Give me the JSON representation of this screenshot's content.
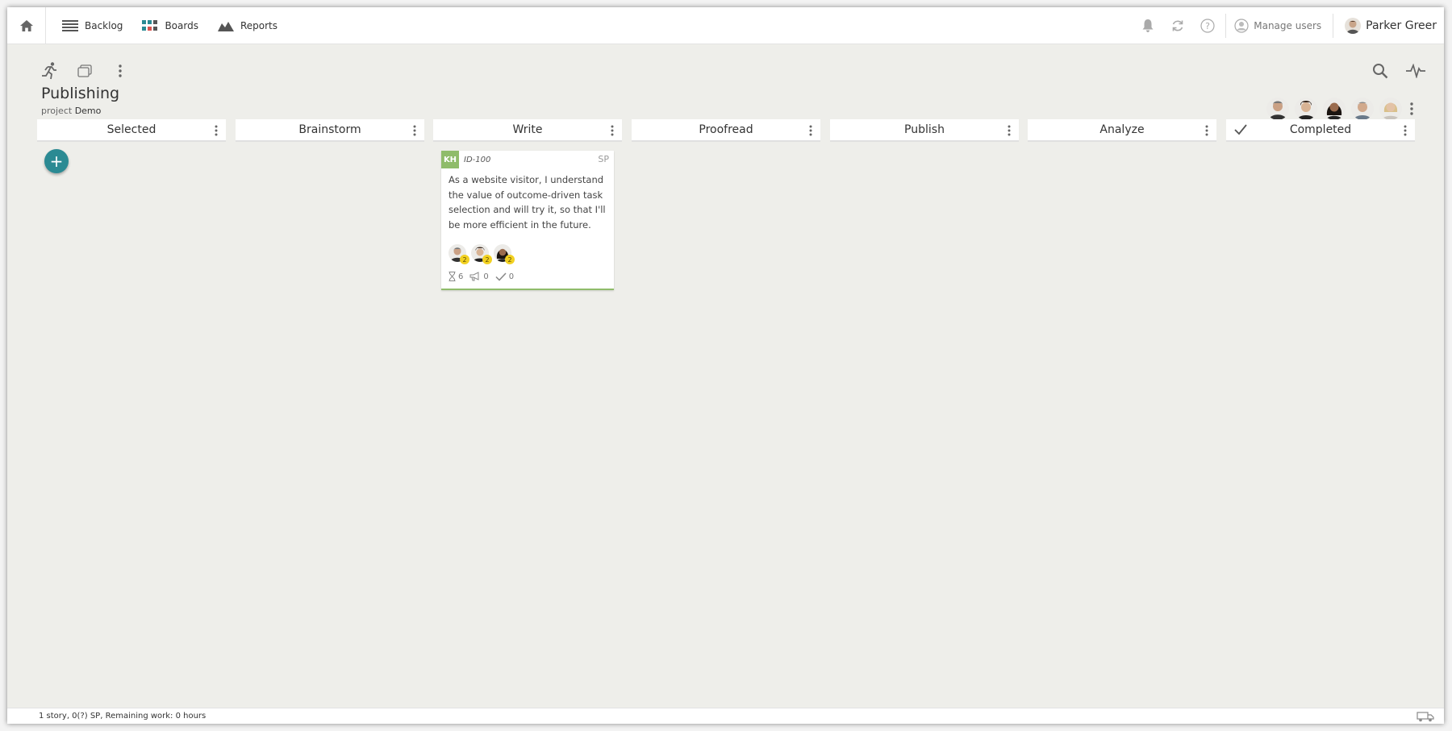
{
  "nav": {
    "items": [
      {
        "label": "Backlog"
      },
      {
        "label": "Boards"
      },
      {
        "label": "Reports"
      }
    ],
    "manage_users": "Manage users",
    "user_name": "Parker Greer"
  },
  "board": {
    "title": "Publishing",
    "subtitle_prefix": "project",
    "project_name": "Demo"
  },
  "columns": [
    {
      "name": "Selected"
    },
    {
      "name": "Brainstorm"
    },
    {
      "name": "Write"
    },
    {
      "name": "Proofread"
    },
    {
      "name": "Publish"
    },
    {
      "name": "Analyze"
    },
    {
      "name": "Completed"
    }
  ],
  "add_button": "+",
  "card": {
    "owner_initials": "KH",
    "id": "ID-100",
    "points": "SP",
    "text": "As a website visitor, I understand the value of outcome-driven task selection and will try it, so that I'll be more efficient in the future.",
    "assignee_badges": [
      "2",
      "2",
      "2"
    ],
    "stats": {
      "hours": "6",
      "feedback": "0",
      "done": "0"
    }
  },
  "status": "1 story, 0(?) SP, Remaining work: 0 hours",
  "colors": {
    "accent": "#2b8a93",
    "card_owner": "#8fbc6a",
    "badge": "#f2d122",
    "background": "#eeeeea"
  }
}
